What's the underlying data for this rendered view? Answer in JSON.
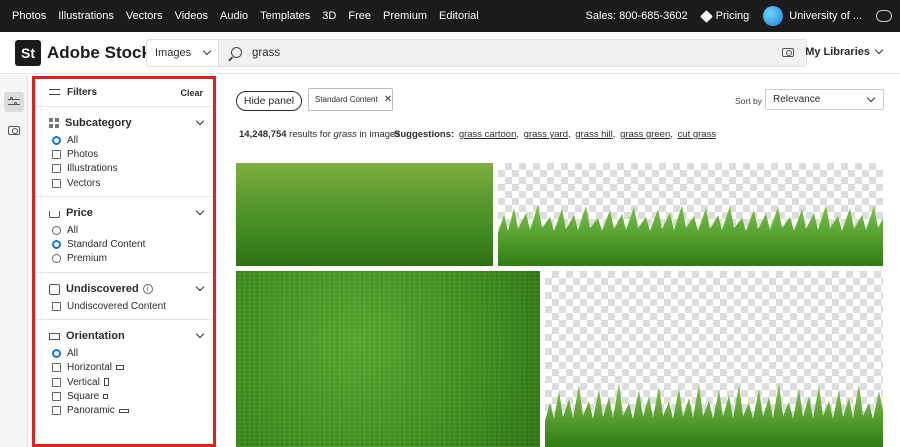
{
  "topnav": {
    "links": [
      "Photos",
      "Illustrations",
      "Vectors",
      "Videos",
      "Audio",
      "Templates",
      "3D",
      "Free",
      "Premium",
      "Editorial"
    ],
    "sales": "Sales: 800-685-3602",
    "pricing": "Pricing",
    "account": "University of ..."
  },
  "header": {
    "logo_mark": "St",
    "logo_text": "Adobe Stock",
    "search_type": "Images",
    "search_query": "grass",
    "my_libraries": "My Libraries"
  },
  "filters": {
    "title": "Filters",
    "clear": "Clear",
    "subcategory": {
      "title": "Subcategory",
      "options": [
        "All",
        "Photos",
        "Illustrations",
        "Vectors"
      ],
      "selected": "All"
    },
    "price": {
      "title": "Price",
      "options": [
        "All",
        "Standard Content",
        "Premium"
      ],
      "selected": "Standard Content"
    },
    "undiscovered": {
      "title": "Undiscovered",
      "options": [
        "Undiscovered Content"
      ]
    },
    "orientation": {
      "title": "Orientation",
      "options": [
        "All",
        "Horizontal",
        "Vertical",
        "Square",
        "Panoramic"
      ],
      "selected": "All"
    }
  },
  "toolbar": {
    "hide_panel": "Hide panel",
    "chip": "Standard Content",
    "sort_label": "Sort by",
    "sort_value": "Relevance"
  },
  "results": {
    "count": "14,248,754",
    "text_mid": " results for ",
    "query": "grass",
    "text_end": " in images",
    "suggestions_label": "Suggestions:",
    "suggestions": [
      "grass cartoon",
      "grass yard",
      "grass hill",
      "grass green",
      "cut grass"
    ]
  },
  "colors": {
    "topnav_bg": "#1b1b1b",
    "highlight_border": "#e0201c",
    "radio_accent": "#1473e6",
    "grass_green": "#3f8a1f"
  }
}
